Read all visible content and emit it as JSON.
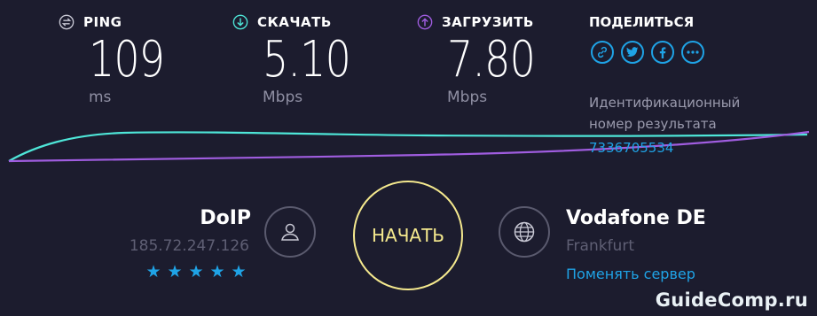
{
  "metrics": {
    "ping": {
      "label": "PING",
      "value": "109",
      "unit": "ms",
      "icon": "ping-icon"
    },
    "download": {
      "label": "СКАЧАТЬ",
      "value": "5.10",
      "unit": "Mbps",
      "icon": "download-arrow-icon"
    },
    "upload": {
      "label": "ЗАГРУЗИТЬ",
      "value": "7.80",
      "unit": "Mbps",
      "icon": "upload-arrow-icon"
    }
  },
  "share": {
    "title": "ПОДЕЛИТЬСЯ",
    "buttons": [
      {
        "icon": "link-icon",
        "glyph": "🔗"
      },
      {
        "icon": "twitter-icon",
        "glyph": "t"
      },
      {
        "icon": "facebook-icon",
        "glyph": "f"
      },
      {
        "icon": "more-icon",
        "glyph": "•••"
      }
    ]
  },
  "result": {
    "label": "Идентификационный номер результата",
    "id": "7336705534"
  },
  "provider": {
    "name": "DoIP",
    "ip": "185.72.247.126",
    "rating": 5
  },
  "start_button": {
    "label": "НАЧАТЬ"
  },
  "server": {
    "name": "Vodafone DE",
    "city": "Frankfurt",
    "change_label": "Поменять сервер"
  },
  "colors": {
    "background": "#1c1c2e",
    "accent_blue": "#1fa3e6",
    "download_line": "#4ee6d8",
    "upload_line": "#a05de0",
    "start_button": "#f5e98e"
  },
  "watermark": "GuideComp.ru"
}
